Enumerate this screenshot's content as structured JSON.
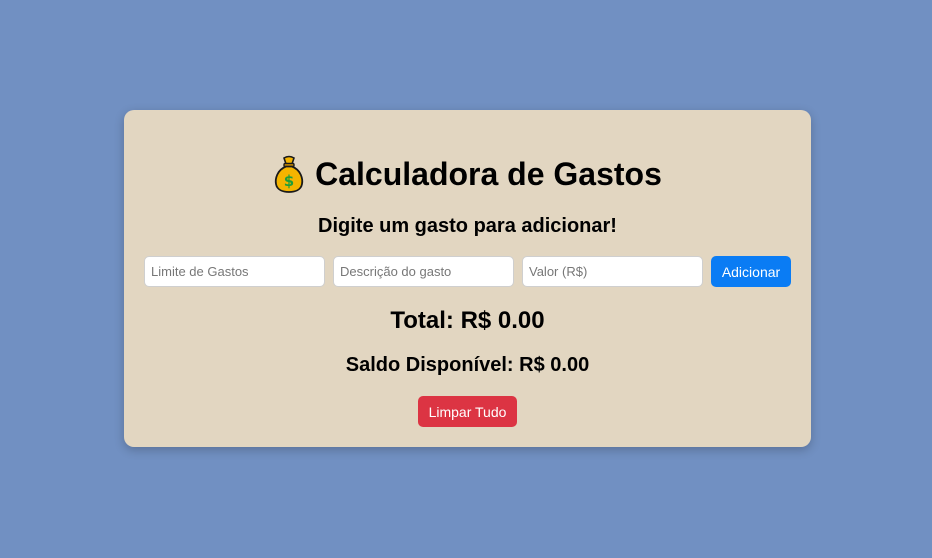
{
  "header": {
    "icon": "money-bag-icon",
    "title": "Calculadora de Gastos",
    "subtitle": "Digite um gasto para adicionar!"
  },
  "form": {
    "limit_placeholder": "Limite de Gastos",
    "description_placeholder": "Descrição do gasto",
    "value_placeholder": "Valor (R$)",
    "add_label": "Adicionar"
  },
  "summary": {
    "total_text": "Total: R$ 0.00",
    "saldo_text": "Saldo Disponível: R$ 0.00"
  },
  "actions": {
    "clear_label": "Limpar Tudo"
  },
  "colors": {
    "background": "#7190c2",
    "card": "#e2d6c1",
    "add_button": "#0a7cf4",
    "clear_button": "#dc3443"
  }
}
